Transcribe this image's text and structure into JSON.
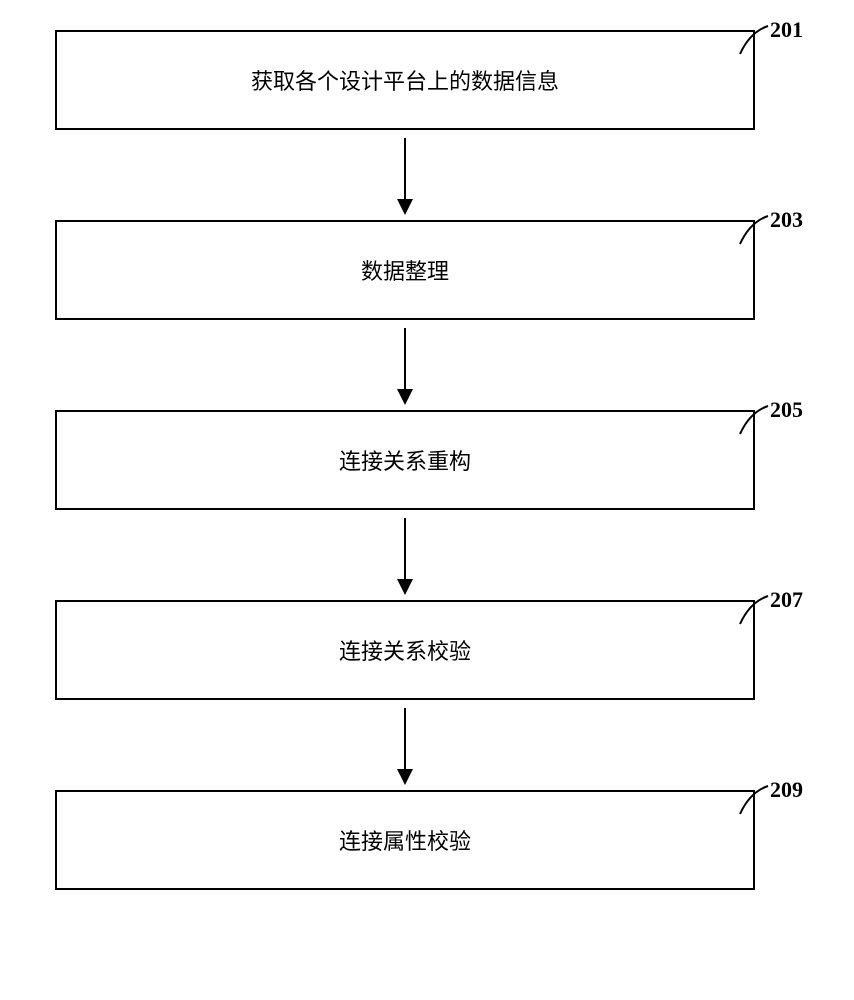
{
  "flowchart": {
    "steps": [
      {
        "label": "201",
        "text": "获取各个设计平台上的数据信息"
      },
      {
        "label": "203",
        "text": "数据整理"
      },
      {
        "label": "205",
        "text": "连接关系重构"
      },
      {
        "label": "207",
        "text": "连接关系校验"
      },
      {
        "label": "209",
        "text": "连接属性校验"
      }
    ]
  }
}
